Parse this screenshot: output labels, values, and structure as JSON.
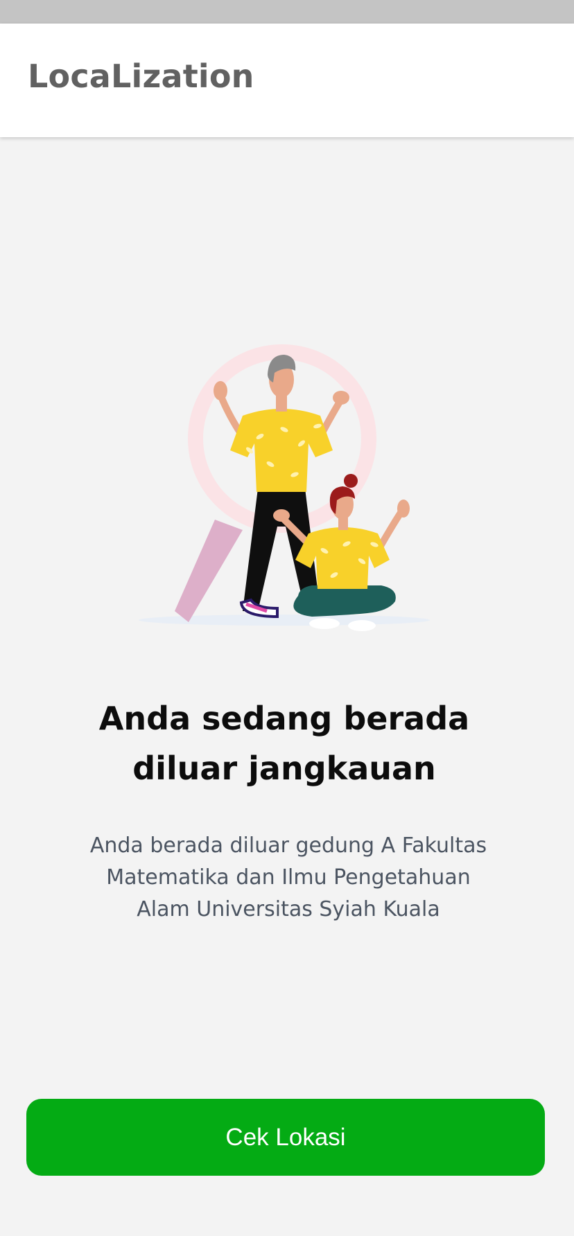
{
  "app_bar": {
    "title": "LocaLization"
  },
  "illustration": {
    "icon": "out-of-range-illustration"
  },
  "message": {
    "headline_line1": "Anda sedang berada",
    "headline_line2": "diluar jangkauan",
    "description_line1": "Anda berada diluar gedung A Fakultas",
    "description_line2": "Matematika dan Ilmu Pengetahuan",
    "description_line3": "Alam Universitas Syiah Kuala"
  },
  "actions": {
    "check_location_label": "Cek Lokasi"
  },
  "colors": {
    "primary_button": "#04ab14",
    "shirt": "#f8d12a",
    "magnifier_ring": "#fbe3e6",
    "magnifier_handle": "#ddafc9"
  }
}
